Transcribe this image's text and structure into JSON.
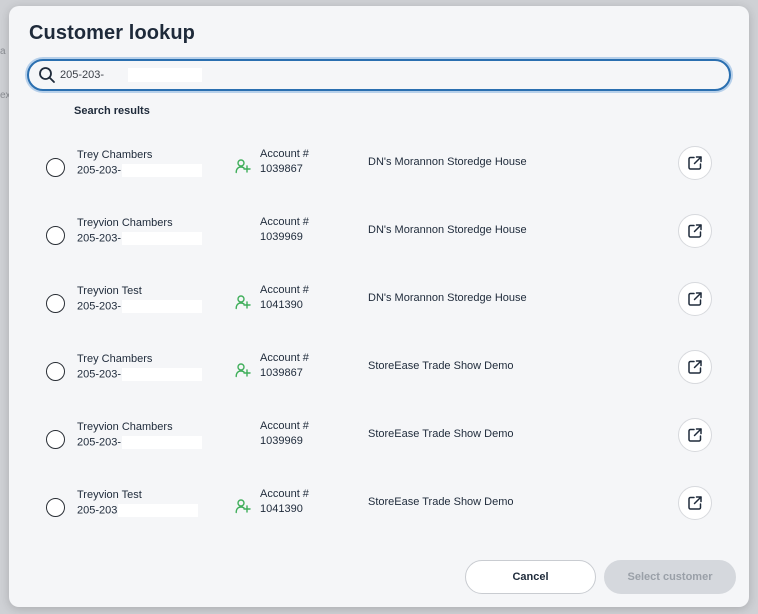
{
  "background": {
    "fragments": [
      "a",
      "ex"
    ]
  },
  "modal": {
    "title": "Customer lookup",
    "search": {
      "value": "205-203-",
      "placeholder": ""
    },
    "results_heading": "Search results",
    "results": [
      {
        "name": "Trey Chambers",
        "phone": "205-203-",
        "has_contact_icon": true,
        "account_label": "Account #",
        "account_number": "1039867",
        "facility": "DN's Morannon Storedge House"
      },
      {
        "name": "Treyvion Chambers",
        "phone": "205-203-",
        "has_contact_icon": false,
        "account_label": "Account #",
        "account_number": "1039969",
        "facility": "DN's Morannon Storedge House"
      },
      {
        "name": "Treyvion Test",
        "phone": "205-203-",
        "has_contact_icon": true,
        "account_label": "Account #",
        "account_number": "1041390",
        "facility": "DN's Morannon Storedge House"
      },
      {
        "name": "Trey Chambers",
        "phone": "205-203-",
        "has_contact_icon": true,
        "account_label": "Account #",
        "account_number": "1039867",
        "facility": "StoreEase Trade Show Demo"
      },
      {
        "name": "Treyvion Chambers",
        "phone": "205-203-",
        "has_contact_icon": false,
        "account_label": "Account #",
        "account_number": "1039969",
        "facility": "StoreEase Trade Show Demo"
      },
      {
        "name": "Treyvion Test",
        "phone": "205-203",
        "has_contact_icon": true,
        "account_label": "Account #",
        "account_number": "1041390",
        "facility": "StoreEase Trade Show Demo"
      }
    ],
    "buttons": {
      "cancel": "Cancel",
      "select": "Select customer"
    }
  },
  "icons": {
    "search": "search-icon",
    "contact": "person-add-icon",
    "open": "external-link-icon"
  },
  "colors": {
    "accent": "#2a6fb0",
    "contact_icon": "#3fae5a",
    "text": "#1e2a3a",
    "disabled_button": "#d5d8dd"
  }
}
